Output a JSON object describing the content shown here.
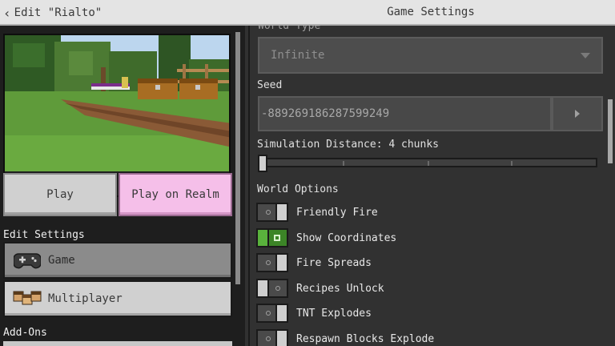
{
  "header": {
    "back_label": "Edit \"Rialto\"",
    "title": "Game Settings"
  },
  "left": {
    "play_label": "Play",
    "realm_label": "Play on Realm",
    "edit_settings_label": "Edit Settings",
    "nav": [
      {
        "label": "Game",
        "icon": "controller-icon",
        "selected": true
      },
      {
        "label": "Multiplayer",
        "icon": "players-icon",
        "selected": false
      }
    ],
    "addons_label": "Add-Ons"
  },
  "right": {
    "world_type_label": "World Type",
    "world_type_value": "Infinite",
    "seed_label": "Seed",
    "seed_value": "-889269186287599249",
    "sim_distance_label": "Simulation Distance: 4 chunks",
    "sim_distance_fraction": 0,
    "world_options_label": "World Options",
    "options": [
      {
        "label": "Friendly Fire",
        "on": false
      },
      {
        "label": "Show Coordinates",
        "on": true
      },
      {
        "label": "Fire Spreads",
        "on": false
      },
      {
        "label": "Recipes Unlock",
        "on": false
      },
      {
        "label": "TNT Explodes",
        "on": false
      },
      {
        "label": "Respawn Blocks Explode",
        "on": false
      }
    ]
  },
  "colors": {
    "header": "#e4e4e4",
    "realm_button": "#f5bfe9",
    "toggle_on": "#3c8527",
    "panel": "#313131"
  }
}
